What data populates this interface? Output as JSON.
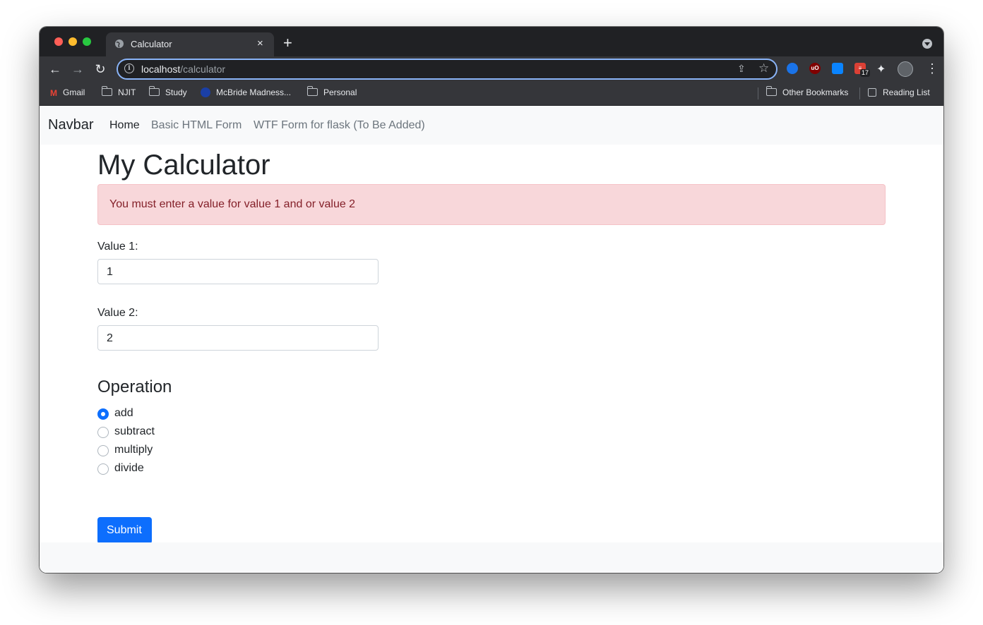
{
  "browser": {
    "tab_title": "Calculator",
    "new_tab": "+",
    "close_tab": "×",
    "url_host": "localhost",
    "url_path": "/calculator",
    "extension_badge": "17",
    "bookmarks": {
      "gmail": "Gmail",
      "njit": "NJIT",
      "study": "Study",
      "mcbride": "McBride Madness...",
      "personal": "Personal",
      "other": "Other Bookmarks",
      "reading_list": "Reading List"
    }
  },
  "navbar": {
    "brand": "Navbar",
    "links": [
      "Home",
      "Basic HTML Form",
      "WTF Form for flask (To Be Added)"
    ]
  },
  "main": {
    "title": "My Calculator",
    "alert": "You must enter a value for value 1 and or value 2",
    "value1_label": "Value 1:",
    "value1": "1",
    "value2_label": "Value 2:",
    "value2": "2",
    "operation_title": "Operation",
    "operations": [
      "add",
      "subtract",
      "multiply",
      "divide"
    ],
    "selected_operation": "add",
    "submit_label": "Submit"
  },
  "colors": {
    "primary": "#0d6efd",
    "alert_bg": "#f8d7da",
    "alert_text": "#842029",
    "navbar_bg": "#f8f9fa"
  }
}
